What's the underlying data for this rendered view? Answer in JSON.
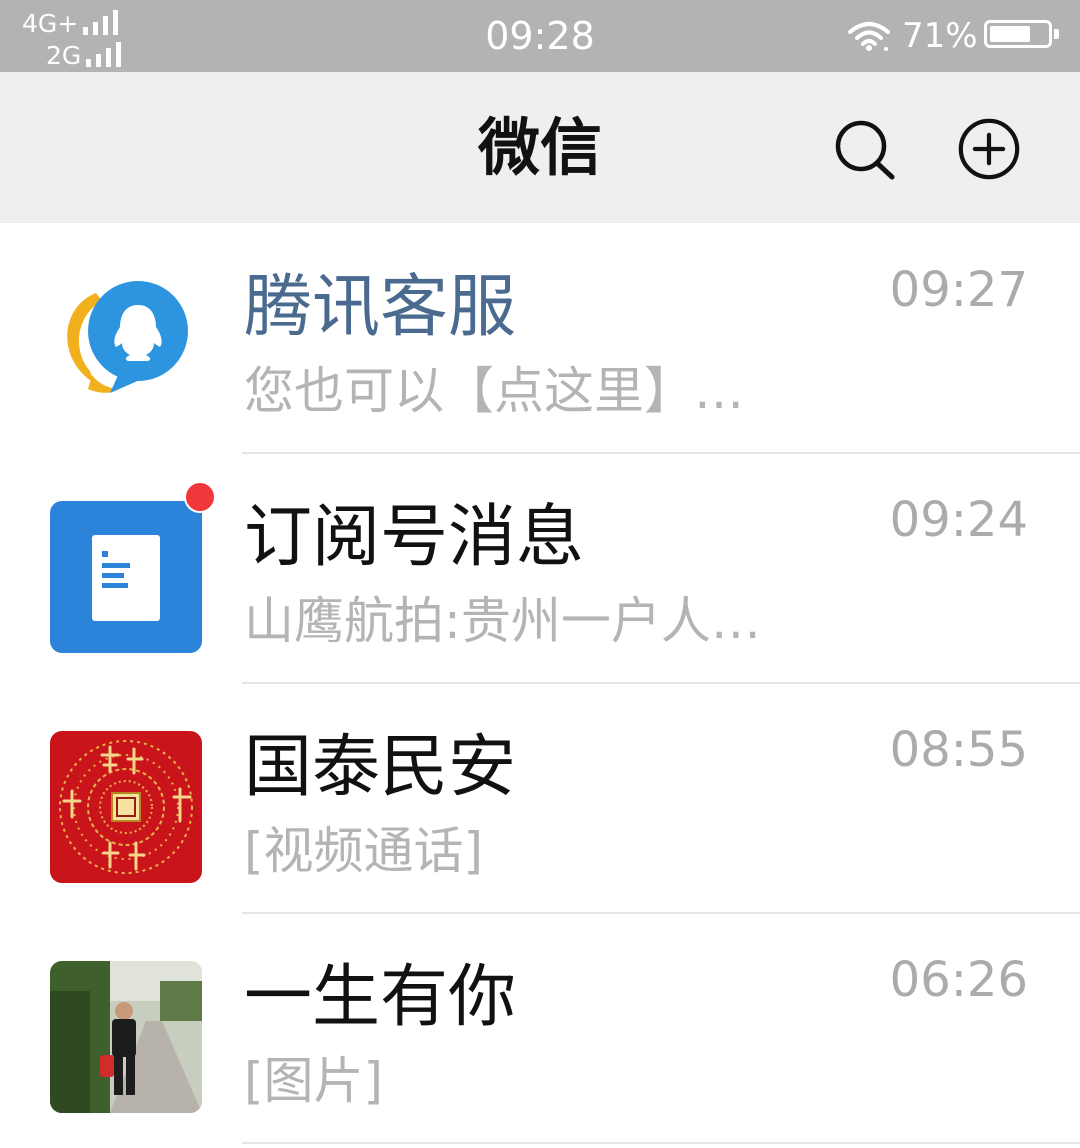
{
  "status_bar": {
    "network_primary": "4G+",
    "network_secondary": "2G",
    "time": "09:28",
    "battery_percent_text": "71%",
    "battery_level": 0.71,
    "icons": [
      "signal-bars-icon",
      "wifi-icon",
      "battery-icon"
    ]
  },
  "header": {
    "title": "微信",
    "icons": [
      "search-icon",
      "plus-circle-icon"
    ]
  },
  "chats": [
    {
      "name": "腾讯客服",
      "preview": "您也可以【点这里】…",
      "time": "09:27",
      "avatar": "tencent-qq-service-icon",
      "name_color": "#4a6a8f",
      "unread_dot": false
    },
    {
      "name": "订阅号消息",
      "preview": "山鹰航拍:贵州一户人…",
      "time": "09:24",
      "avatar": "subscription-document-icon",
      "avatar_color": "#2b84d9",
      "unread_dot": true
    },
    {
      "name": "国泰民安",
      "preview": "[视频通话]",
      "time": "08:55",
      "avatar": "red-calligraphy-avatar",
      "avatar_color": "#c9141b",
      "unread_dot": false
    },
    {
      "name": "一生有你",
      "preview": "[图片]",
      "time": "06:26",
      "avatar": "photo-person-avatar",
      "unread_dot": false
    }
  ],
  "colors": {
    "status_bar_bg": "#b3b3b3",
    "nav_bar_bg": "#efefef",
    "unread_badge": "#f0383b"
  }
}
